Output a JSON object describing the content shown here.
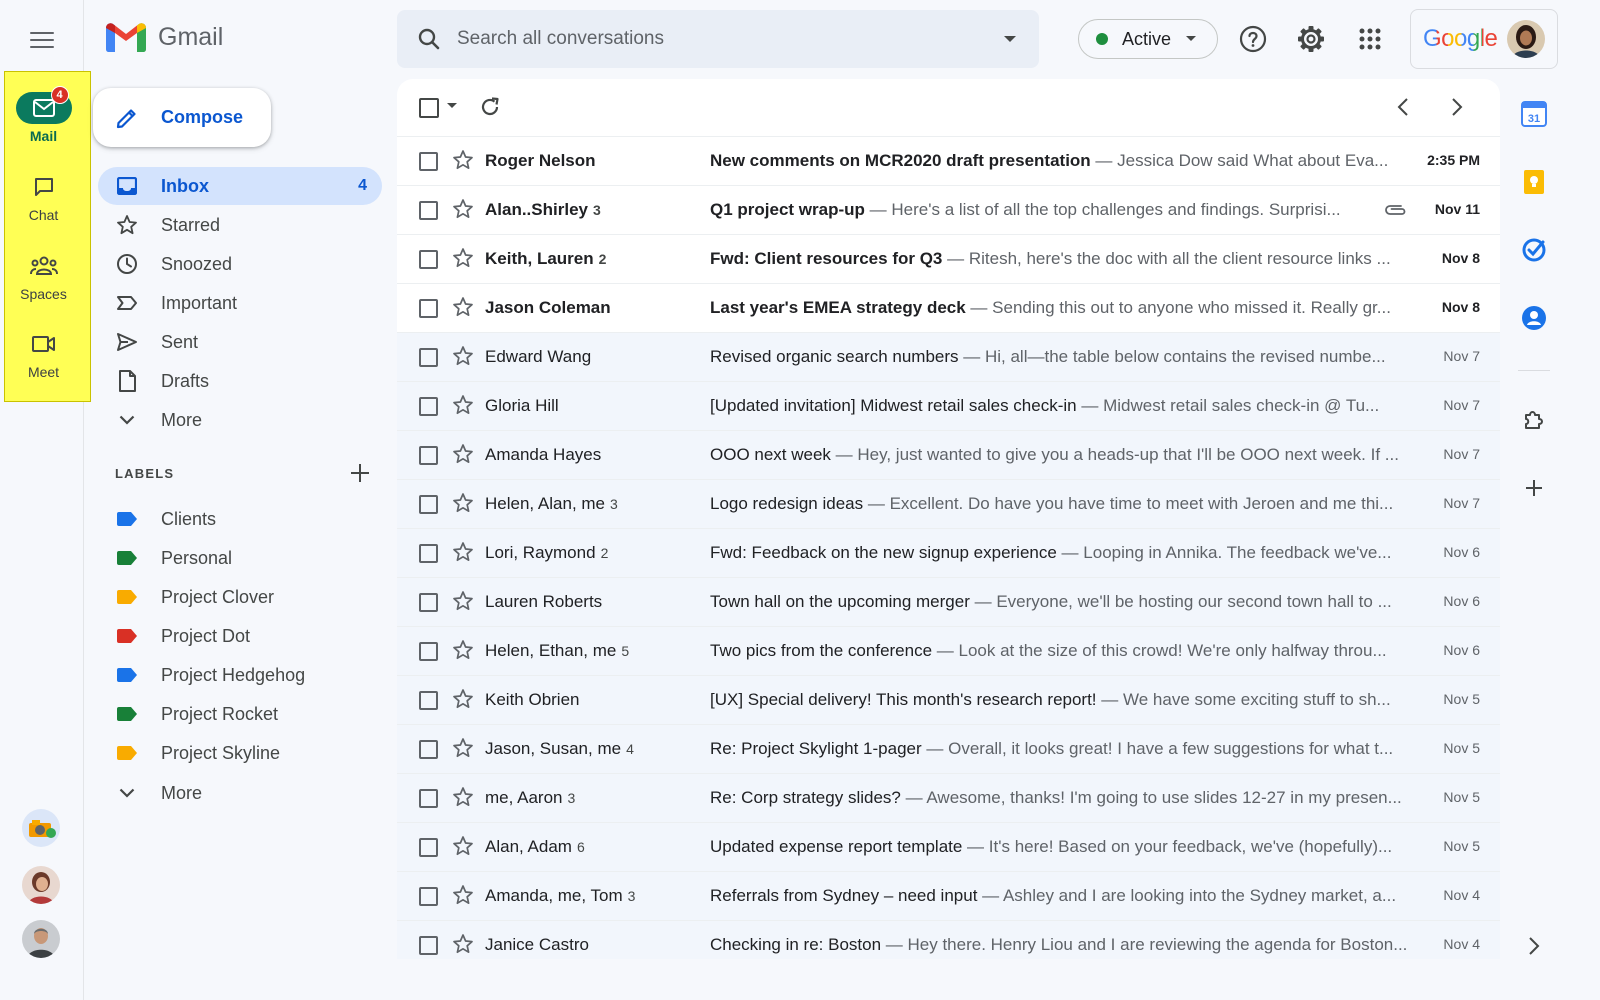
{
  "app": {
    "name": "Gmail"
  },
  "rail": {
    "items": [
      {
        "label": "Mail",
        "badge": "4"
      },
      {
        "label": "Chat"
      },
      {
        "label": "Spaces"
      },
      {
        "label": "Meet"
      }
    ]
  },
  "search": {
    "placeholder": "Search all conversations"
  },
  "status": {
    "label": "Active",
    "color": "#1e8e3e"
  },
  "account": {
    "brand": "Google"
  },
  "compose": {
    "label": "Compose"
  },
  "nav": {
    "items": [
      {
        "label": "Inbox",
        "count": "4",
        "icon": "inbox-icon",
        "selected": true
      },
      {
        "label": "Starred",
        "icon": "star-icon"
      },
      {
        "label": "Snoozed",
        "icon": "clock-icon"
      },
      {
        "label": "Important",
        "icon": "important-icon"
      },
      {
        "label": "Sent",
        "icon": "send-icon"
      },
      {
        "label": "Drafts",
        "icon": "draft-icon"
      },
      {
        "label": "More",
        "icon": "chevron-down-icon"
      }
    ]
  },
  "labels": {
    "heading": "LABELS",
    "items": [
      {
        "label": "Clients",
        "color": "#1a73e8"
      },
      {
        "label": "Personal",
        "color": "#188038"
      },
      {
        "label": "Project Clover",
        "color": "#f9ab00"
      },
      {
        "label": "Project Dot",
        "color": "#d93025"
      },
      {
        "label": "Project Hedgehog",
        "color": "#1a73e8"
      },
      {
        "label": "Project Rocket",
        "color": "#188038"
      },
      {
        "label": "Project Skyline",
        "color": "#f9ab00"
      }
    ],
    "more": "More"
  },
  "emails": [
    {
      "sender": "Roger Nelson",
      "count": "",
      "subject": "New comments on MCR2020 draft presentation",
      "snippet": "Jessica Dow said What about Eva...",
      "date": "2:35 PM",
      "unread": true,
      "attachment": false
    },
    {
      "sender": "Alan..Shirley",
      "count": "3",
      "subject": "Q1 project wrap-up ",
      "snippet": "Here's a list of all the top challenges and findings. Surprisi...",
      "date": "Nov 11",
      "unread": true,
      "attachment": true
    },
    {
      "sender": "Keith, Lauren",
      "count": "2",
      "subject": "Fwd: Client resources for Q3",
      "snippet": "Ritesh, here's the doc with all the client resource links ...",
      "date": "Nov 8",
      "unread": true,
      "attachment": false
    },
    {
      "sender": "Jason Coleman",
      "count": "",
      "subject": "Last year's EMEA strategy deck",
      "snippet": "Sending this out to anyone who missed it. Really gr...",
      "date": "Nov 8",
      "unread": true,
      "attachment": false
    },
    {
      "sender": "Edward Wang",
      "count": "",
      "subject": "Revised organic search numbers",
      "snippet": "Hi, all—the table below contains the revised numbe...",
      "date": "Nov 7",
      "unread": false,
      "attachment": false
    },
    {
      "sender": "Gloria Hill",
      "count": "",
      "subject": "[Updated invitation] Midwest retail sales check-in",
      "snippet": "Midwest retail sales check-in @ Tu...",
      "date": "Nov 7",
      "unread": false,
      "attachment": false
    },
    {
      "sender": "Amanda Hayes",
      "count": "",
      "subject": "OOO next week",
      "snippet": "Hey, just wanted to give you a heads-up that I'll be OOO next week. If ...",
      "date": "Nov 7",
      "unread": false,
      "attachment": false
    },
    {
      "sender": "Helen, Alan, me",
      "count": "3",
      "subject": "Logo redesign ideas",
      "snippet": "Excellent. Do have you have time to meet with Jeroen and me thi...",
      "date": "Nov 7",
      "unread": false,
      "attachment": false
    },
    {
      "sender": "Lori, Raymond",
      "count": "2",
      "subject": "Fwd: Feedback on the new signup experience",
      "snippet": "Looping in Annika. The feedback we've...",
      "date": "Nov 6",
      "unread": false,
      "attachment": false
    },
    {
      "sender": "Lauren Roberts",
      "count": "",
      "subject": "Town hall on the upcoming merger",
      "snippet": "Everyone, we'll be hosting our second town hall to ...",
      "date": "Nov 6",
      "unread": false,
      "attachment": false
    },
    {
      "sender": "Helen, Ethan, me",
      "count": "5",
      "subject": "Two pics from the conference",
      "snippet": "Look at the size of this crowd! We're only halfway throu...",
      "date": "Nov 6",
      "unread": false,
      "attachment": false
    },
    {
      "sender": "Keith Obrien",
      "count": "",
      "subject": "[UX] Special delivery! This month's research report!",
      "snippet": "We have some exciting stuff to sh...",
      "date": "Nov 5",
      "unread": false,
      "attachment": false
    },
    {
      "sender": "Jason, Susan, me",
      "count": "4",
      "subject": "Re: Project Skylight 1-pager",
      "snippet": "Overall, it looks great! I have a few suggestions for what t...",
      "date": "Nov 5",
      "unread": false,
      "attachment": false
    },
    {
      "sender": "me, Aaron",
      "count": "3",
      "subject": "Re: Corp strategy slides?",
      "snippet": "Awesome, thanks! I'm going to use slides 12-27 in my presen...",
      "date": "Nov 5",
      "unread": false,
      "attachment": false
    },
    {
      "sender": "Alan, Adam",
      "count": "6",
      "subject": "Updated expense report template",
      "snippet": "It's here! Based on your feedback, we've (hopefully)...",
      "date": "Nov 5",
      "unread": false,
      "attachment": false
    },
    {
      "sender": "Amanda, me, Tom",
      "count": "3",
      "subject": "Referrals from Sydney – need input",
      "snippet": "Ashley and I are looking into the Sydney market, a...",
      "date": "Nov 4",
      "unread": false,
      "attachment": false
    },
    {
      "sender": "Janice Castro",
      "count": "",
      "subject": "Checking in re: Boston",
      "snippet": "Hey there. Henry Liou and I are reviewing the agenda for Boston...",
      "date": "Nov 4",
      "unread": false,
      "attachment": false
    }
  ],
  "side_apps": [
    {
      "icon": "calendar-icon",
      "label": "31"
    },
    {
      "icon": "keep-icon"
    },
    {
      "icon": "tasks-icon"
    },
    {
      "icon": "contacts-icon"
    },
    {
      "icon": "addons-icon"
    },
    {
      "icon": "add-icon"
    }
  ]
}
